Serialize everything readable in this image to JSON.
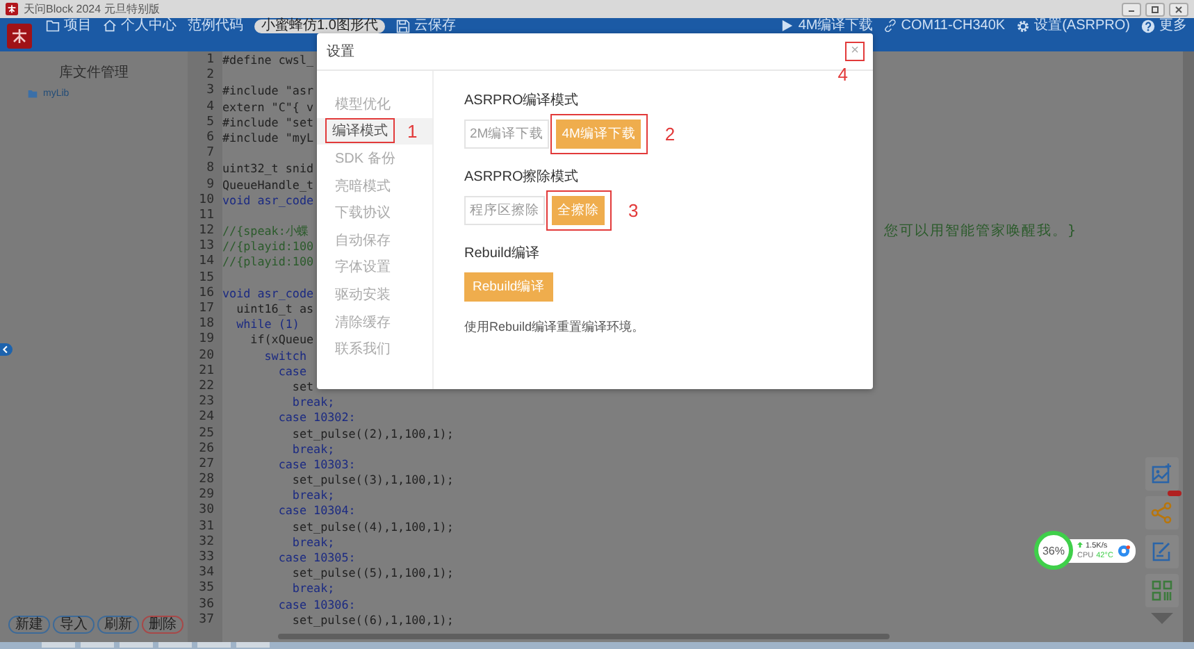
{
  "title_bar": {
    "title": "天问Block 2024 元旦特别版"
  },
  "toolbar": {
    "left_items": [
      {
        "label": "项目",
        "kind": "folder"
      },
      {
        "label": "个人中心",
        "kind": "home"
      },
      {
        "label": "范例代码",
        "kind": "text"
      },
      {
        "label": "小蜜蜂仿1.0图形代",
        "kind": "pill"
      },
      {
        "label": "云保存",
        "kind": "save"
      }
    ],
    "right_items": [
      {
        "label": "4M编译下载",
        "kind": "play"
      },
      {
        "label": "COM11-CH340K",
        "kind": "link"
      },
      {
        "label": "设置(ASRPRO)",
        "kind": "gear"
      },
      {
        "label": "更多",
        "kind": "help"
      }
    ]
  },
  "library_panel": {
    "title": "库文件管理",
    "items": [
      {
        "label": "myLib"
      }
    ],
    "buttons": [
      {
        "label": "新建",
        "kind": "normal"
      },
      {
        "label": "导入",
        "kind": "normal"
      },
      {
        "label": "刷新",
        "kind": "normal"
      },
      {
        "label": "删除",
        "kind": "danger"
      }
    ]
  },
  "editor": {
    "lines": [
      {
        "number": "1",
        "text": "#define cwsl_",
        "kind": "code"
      },
      {
        "number": "2",
        "kind": "code"
      },
      {
        "number": "3",
        "text": "#include \"asr",
        "kind": "code"
      },
      {
        "number": "4",
        "text": "extern \"C\"{ v",
        "kind": "code"
      },
      {
        "number": "5",
        "text": "#include \"set",
        "kind": "code"
      },
      {
        "number": "6",
        "text": "#include \"myL",
        "kind": "code"
      },
      {
        "number": "7",
        "kind": "code"
      },
      {
        "number": "8",
        "text": "uint32_t snid",
        "kind": "code"
      },
      {
        "number": "9",
        "text": "QueueHandle_t",
        "kind": "code"
      },
      {
        "number": "10",
        "text": "void asr_code",
        "kind": "keyword"
      },
      {
        "number": "11",
        "kind": "code"
      },
      {
        "number": "12",
        "text": "//{speak:小蝶",
        "kind": "comment",
        "tail": "您可以用智能管家唤醒我。}"
      },
      {
        "number": "13",
        "text": "//{playid:100",
        "kind": "comment"
      },
      {
        "number": "14",
        "text": "//{playid:100",
        "kind": "comment"
      },
      {
        "number": "15",
        "kind": "code"
      },
      {
        "number": "16",
        "text": "void asr_code",
        "kind": "keyword"
      },
      {
        "number": "17",
        "text": "  uint16_t as",
        "kind": "code"
      },
      {
        "number": "18",
        "text": "  while (1)",
        "kind": "keyword"
      },
      {
        "number": "19",
        "text": "    if(xQueue",
        "kind": "code"
      },
      {
        "number": "20",
        "text": "      switch",
        "kind": "keyword"
      },
      {
        "number": "21",
        "text": "        case",
        "kind": "keyword"
      },
      {
        "number": "22",
        "text": "          set",
        "kind": "code"
      },
      {
        "number": "23",
        "text": "          break;",
        "kind": "keyword"
      },
      {
        "number": "24",
        "text": "        case 10302:",
        "kind": "keyword"
      },
      {
        "number": "25",
        "text": "          set_pulse((2),1,100,1);",
        "kind": "code"
      },
      {
        "number": "26",
        "text": "          break;",
        "kind": "keyword"
      },
      {
        "number": "27",
        "text": "        case 10303:",
        "kind": "keyword"
      },
      {
        "number": "28",
        "text": "          set_pulse((3),1,100,1);",
        "kind": "code"
      },
      {
        "number": "29",
        "text": "          break;",
        "kind": "keyword"
      },
      {
        "number": "30",
        "text": "        case 10304:",
        "kind": "keyword"
      },
      {
        "number": "31",
        "text": "          set_pulse((4),1,100,1);",
        "kind": "code"
      },
      {
        "number": "32",
        "text": "          break;",
        "kind": "keyword"
      },
      {
        "number": "33",
        "text": "        case 10305:",
        "kind": "keyword"
      },
      {
        "number": "34",
        "text": "          set_pulse((5),1,100,1);",
        "kind": "code"
      },
      {
        "number": "35",
        "text": "          break;",
        "kind": "keyword"
      },
      {
        "number": "36",
        "text": "        case 10306:",
        "kind": "keyword"
      },
      {
        "number": "37",
        "text": "          set_pulse((6),1,100,1);",
        "kind": "code"
      }
    ]
  },
  "settings_dialog": {
    "title": "设置",
    "close": {
      "label": "×",
      "annotation": "4"
    },
    "nav": [
      {
        "label": "模型优化",
        "selected": false
      },
      {
        "label": "编译模式",
        "selected": true,
        "annotation": "1"
      },
      {
        "label": "SDK 备份",
        "selected": false
      },
      {
        "label": "亮暗模式",
        "selected": false
      },
      {
        "label": "下载协议",
        "selected": false
      },
      {
        "label": "自动保存",
        "selected": false
      },
      {
        "label": "字体设置",
        "selected": false
      },
      {
        "label": "驱动安装",
        "selected": false
      },
      {
        "label": "清除缓存",
        "selected": false
      },
      {
        "label": "联系我们",
        "selected": false
      }
    ],
    "sections": [
      {
        "kind": "segmented",
        "heading": "ASRPRO编译模式",
        "options": [
          {
            "label": "2M编译下载",
            "selected": false
          },
          {
            "label": "4M编译下载",
            "selected": true,
            "annotation": "2"
          }
        ]
      },
      {
        "kind": "segmented",
        "heading": "ASRPRO擦除模式",
        "options": [
          {
            "label": "程序区擦除",
            "selected": false
          },
          {
            "label": "全擦除",
            "selected": true,
            "annotation": "3"
          }
        ]
      },
      {
        "kind": "action",
        "heading": "Rebuild编译",
        "button": "Rebuild编译",
        "note": "使用Rebuild编译重置编译环境。"
      }
    ]
  },
  "system_monitor": {
    "percent": "36%",
    "speed": "1.5K/s",
    "cpu_label": "CPU",
    "temperature": "42°C"
  }
}
